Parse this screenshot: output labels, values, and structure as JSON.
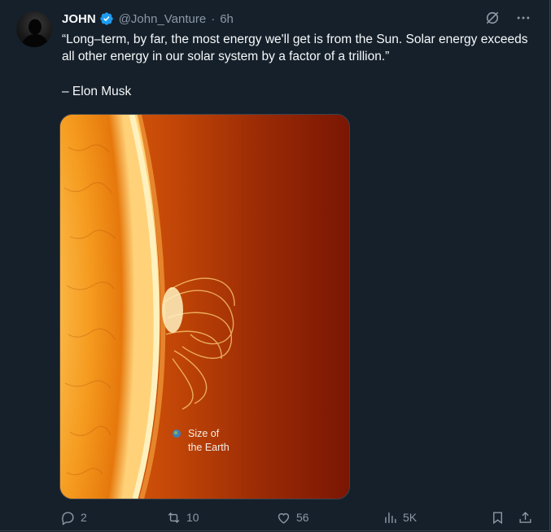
{
  "tweet": {
    "author_name": "JOHN",
    "handle": "@John_Vanture",
    "separator": "·",
    "time": "6h",
    "text_line": "“Long–term, by far, the most energy we'll get is from the Sun. Solar energy exceeds all other energy in our solar system by a factor of a trillion.”",
    "attribution": "– Elon Musk",
    "media": {
      "label_line1": "Size of",
      "label_line2": "the Earth"
    },
    "actions": {
      "replies": "2",
      "reposts": "10",
      "likes": "56",
      "views": "5K"
    }
  },
  "colors": {
    "background": "#15202b",
    "secondary_text": "#8b98a5",
    "verified_blue": "#1d9bf0"
  },
  "icons": [
    "grok-icon",
    "more-icon",
    "verified-badge-icon",
    "reply-icon",
    "repost-icon",
    "like-icon",
    "views-icon",
    "bookmark-icon",
    "share-icon"
  ]
}
